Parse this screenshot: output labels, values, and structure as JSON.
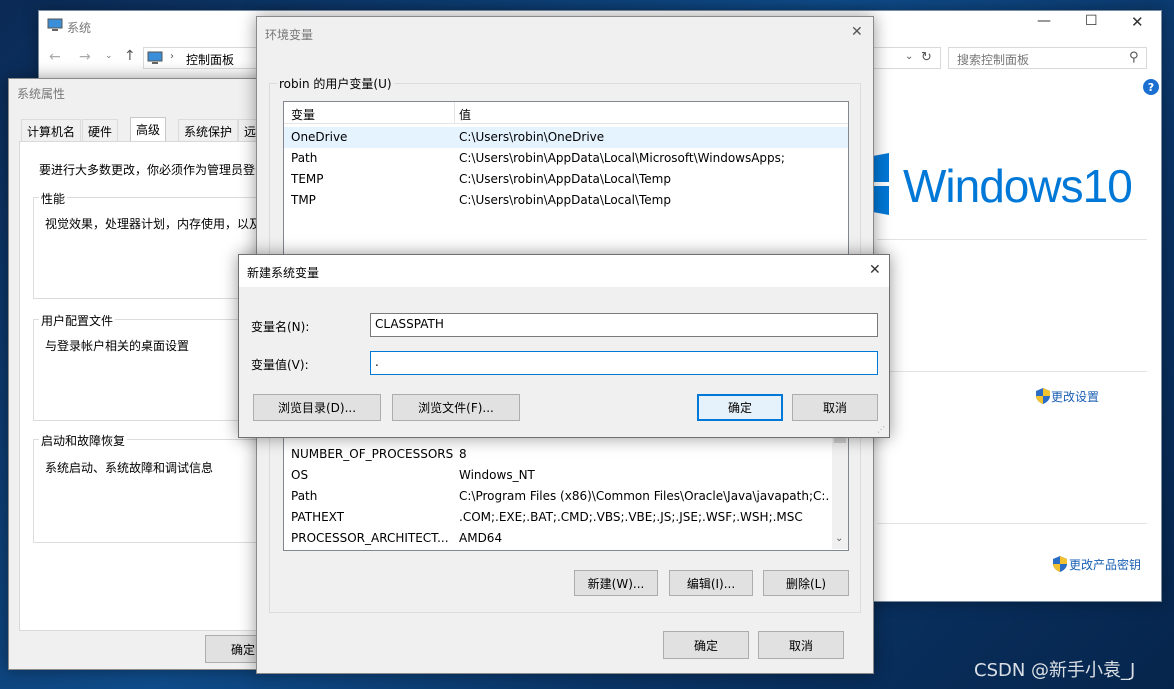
{
  "control_panel": {
    "title": "系统",
    "breadcrumb": "控制面板",
    "search_placeholder": "搜索控制面板",
    "windows_logo_text": "Windows10",
    "change_settings": "更改设置",
    "change_product_key": "更改产品密钥"
  },
  "system_properties": {
    "title": "系统属性",
    "tabs": [
      "计算机名",
      "硬件",
      "高级",
      "系统保护",
      "远程"
    ],
    "active_tab": "高级",
    "admin_note": "要进行大多数更改，你必须作为管理员登录",
    "groups": [
      {
        "title": "性能",
        "desc": "视觉效果，处理器计划，内存使用，以及虚拟内存"
      },
      {
        "title": "用户配置文件",
        "desc": "与登录帐户相关的桌面设置"
      },
      {
        "title": "启动和故障恢复",
        "desc": "系统启动、系统故障和调试信息"
      }
    ],
    "ok_label": "确定"
  },
  "env_vars": {
    "title": "环境变量",
    "user_section_label": "robin 的用户变量(U)",
    "headers": [
      "变量",
      "值"
    ],
    "user_vars": [
      {
        "name": "OneDrive",
        "value": "C:\\Users\\robin\\OneDrive"
      },
      {
        "name": "Path",
        "value": "C:\\Users\\robin\\AppData\\Local\\Microsoft\\WindowsApps;"
      },
      {
        "name": "TEMP",
        "value": "C:\\Users\\robin\\AppData\\Local\\Temp"
      },
      {
        "name": "TMP",
        "value": "C:\\Users\\robin\\AppData\\Local\\Temp"
      }
    ],
    "system_vars": [
      {
        "name": "NUMBER_OF_PROCESSORS",
        "value": "8"
      },
      {
        "name": "OS",
        "value": "Windows_NT"
      },
      {
        "name": "Path",
        "value": "C:\\Program Files (x86)\\Common Files\\Oracle\\Java\\javapath;C:..."
      },
      {
        "name": "PATHEXT",
        "value": ".COM;.EXE;.BAT;.CMD;.VBS;.VBE;.JS;.JSE;.WSF;.WSH;.MSC"
      },
      {
        "name": "PROCESSOR_ARCHITECT...",
        "value": "AMD64"
      }
    ],
    "new_label": "新建(W)...",
    "edit_label": "编辑(I)...",
    "delete_label": "删除(L)",
    "ok_label": "确定",
    "cancel_label": "取消"
  },
  "new_var_dialog": {
    "title": "新建系统变量",
    "name_label": "变量名(N):",
    "name_value": "CLASSPATH",
    "value_label": "变量值(V):",
    "value_value": ".",
    "browse_dir_label": "浏览目录(D)...",
    "browse_file_label": "浏览文件(F)...",
    "ok_label": "确定",
    "cancel_label": "取消"
  },
  "watermark": "CSDN @新手小袁_J",
  "colors": {
    "accent": "#0078d7",
    "logo_blue": "#0078d7",
    "selection": "#e5f3ff"
  },
  "icons": {
    "help": "help-icon",
    "shield": "uac-shield-icon",
    "search": "search-icon"
  }
}
